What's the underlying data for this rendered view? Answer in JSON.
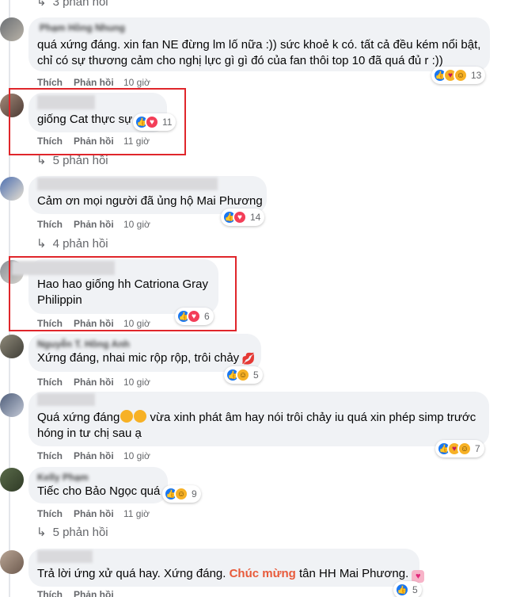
{
  "ui": {
    "like": "Thích",
    "reply": "Phản hồi"
  },
  "top_replies": "3 phản hồi",
  "comments": [
    {
      "author": "Phạm Hồng Nhung",
      "lines": [
        "quá xứng đáng. xin fan NE đừng lm lố nữa :)) sức khoẻ k có. tất cả đều kém nổi bật,",
        "chỉ có sự thương cảm cho nghị lực gì gì đó của fan thôi top 10 đã quá đủ r :))"
      ],
      "time": "10 giờ",
      "reaction_count": "13",
      "reactions": [
        "like-icon",
        "care-icon",
        "haha-icon"
      ]
    },
    {
      "author": "",
      "lines": [
        "giống Cat thực sự"
      ],
      "time": "11 giờ",
      "reaction_count": "11",
      "reactions": [
        "like-icon",
        "love-icon"
      ],
      "replies": "5 phản hồi"
    },
    {
      "author": "",
      "lines": [
        "Cảm ơn mọi người đã ủng hộ Mai Phương"
      ],
      "time": "10 giờ",
      "reaction_count": "14",
      "reactions": [
        "like-icon",
        "love-icon"
      ],
      "replies": "4 phản hồi"
    },
    {
      "author": "",
      "lines": [
        "Hao hao giống hh Catriona Gray",
        "Philippin"
      ],
      "time": "10 giờ",
      "reaction_count": "6",
      "reactions": [
        "like-icon",
        "love-icon"
      ]
    },
    {
      "author": "Nguyễn T. Hồng Anh",
      "lines": [
        "Xứng đáng, nhai mic rộp rộp, trôi chảy"
      ],
      "time": "10 giờ",
      "reaction_count": "5",
      "reactions": [
        "like-icon",
        "haha-icon"
      ]
    },
    {
      "author": "",
      "lines": [
        "Quá xứng đáng",
        "vừa xinh phát âm hay nói trôi chảy iu quá xin phép simp trước",
        "hóng in tư chị sau ạ"
      ],
      "time": "10 giờ",
      "reaction_count": "7",
      "reactions": [
        "like-icon",
        "care-icon",
        "haha-icon"
      ]
    },
    {
      "author": "Kelly Phạm",
      "lines": [
        "Tiếc cho Bảo Ngọc quá"
      ],
      "time": "11 giờ",
      "reaction_count": "9",
      "reactions": [
        "like-icon",
        "haha-icon"
      ],
      "replies": "5 phản hồi"
    },
    {
      "author": "",
      "lines": [
        "Trả lời ứng xử quá hay. Xứng đáng. ",
        "Chúc mừng",
        " tân HH Mai Phương."
      ],
      "time": "",
      "reaction_count": "5",
      "reactions": [
        "like-icon"
      ]
    }
  ],
  "colors": {
    "highlight": "#e0262b",
    "bubble": "#f0f2f5",
    "secondary_text": "#65676b",
    "accent_orange": "#e85a3a"
  }
}
